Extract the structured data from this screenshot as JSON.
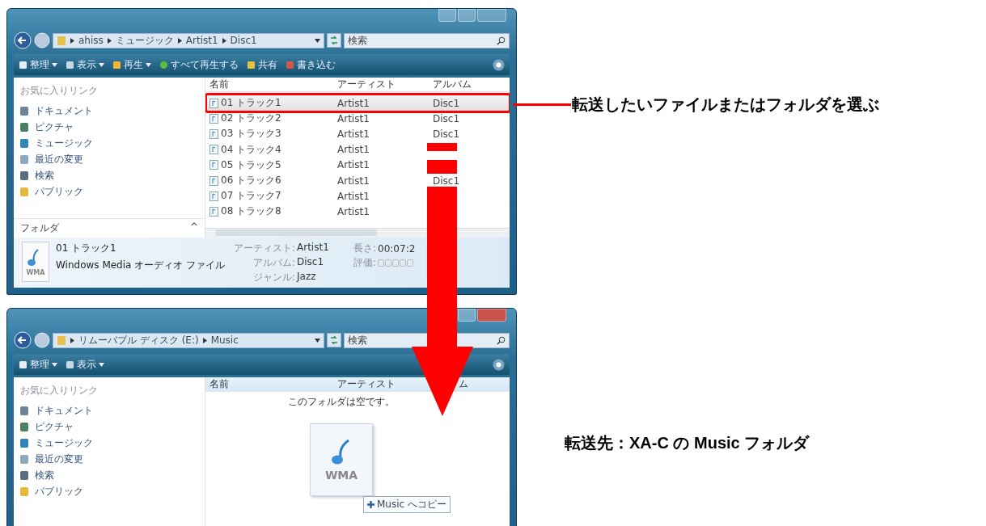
{
  "callouts": [
    "転送したいファイルまたはフォルダを選ぶ",
    "転送先：XA-C の Music フォルダ"
  ],
  "windows": [
    {
      "address": [
        "ahiss",
        "ミュージック",
        "Artist1",
        "Disc1"
      ],
      "search": {
        "placeholder": "検索"
      },
      "toolbar": [
        {
          "label": "整理",
          "dropdown": true
        },
        {
          "label": "表示",
          "dropdown": true
        },
        {
          "label": "再生",
          "dropdown": true
        },
        {
          "label": "すべて再生する",
          "dropdown": false
        },
        {
          "label": "共有",
          "dropdown": false
        },
        {
          "label": "書き込む",
          "dropdown": false
        }
      ],
      "favorites": {
        "heading": "お気に入りリンク",
        "items": [
          "ドキュメント",
          "ピクチャ",
          "ミュージック",
          "最近の変更",
          "検索",
          "パブリック"
        ]
      },
      "folders": {
        "label": "フォルダ",
        "toggle": "^"
      },
      "columns": [
        "名前",
        "アーティスト",
        "アルバム"
      ],
      "rows": [
        {
          "name": "01 トラック1",
          "artist": "Artist1",
          "album": "Disc1",
          "selected": true
        },
        {
          "name": "02 トラック2",
          "artist": "Artist1",
          "album": "Disc1",
          "selected": false
        },
        {
          "name": "03 トラック3",
          "artist": "Artist1",
          "album": "Disc1",
          "selected": false
        },
        {
          "name": "04 トラック4",
          "artist": "Artist1",
          "selected": false
        },
        {
          "name": "05 トラック5",
          "artist": "Artist1",
          "selected": false
        },
        {
          "name": "06 トラック6",
          "artist": "Artist1",
          "album": "Disc1",
          "selected": false
        },
        {
          "name": "07 トラック7",
          "artist": "Artist1",
          "selected": false
        },
        {
          "name": "08 トラック8",
          "artist": "Artist1",
          "selected": false
        }
      ],
      "details": {
        "title": "01 トラック1",
        "type": "Windows Media オーディオ ファイル",
        "file_badge": "WMA",
        "fields": [
          {
            "label": "アーティスト:",
            "value": "Artist1"
          },
          {
            "label": "アルバム:",
            "value": "Disc1"
          },
          {
            "label": "ジャンル:",
            "value": "Jazz"
          }
        ],
        "length": {
          "label": "長さ:",
          "value": "00:07:2"
        },
        "rating": {
          "label": "評価:",
          "stars": 0
        }
      }
    },
    {
      "address": [
        "リムーバブル ディスク (E:)",
        "Music"
      ],
      "search": {
        "placeholder": "検索"
      },
      "toolbar": [
        {
          "label": "整理",
          "dropdown": true
        },
        {
          "label": "表示",
          "dropdown": true
        }
      ],
      "favorites": {
        "heading": "お気に入りリンク",
        "items": [
          "ドキュメント",
          "ピクチャ",
          "ミュージック",
          "最近の変更",
          "検索",
          "パブリック"
        ]
      },
      "columns": [
        "名前",
        "アーティスト",
        "ム"
      ],
      "empty_message": "このフォルダは空です。",
      "drag": {
        "file_badge": "WMA",
        "tooltip": "Music へコピー"
      }
    }
  ]
}
